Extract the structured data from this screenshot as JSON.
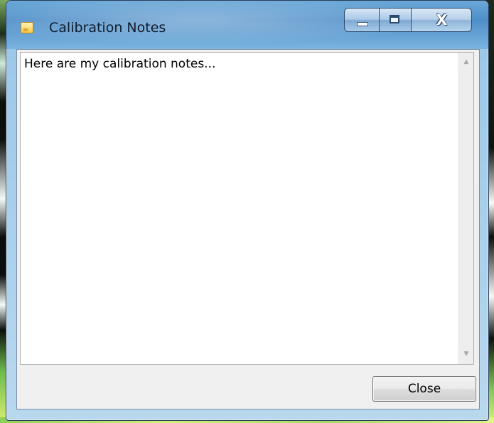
{
  "window": {
    "title": "Calibration Notes",
    "caption_buttons": {
      "minimize_icon": "minimize-icon",
      "maximize_icon": "maximize-icon",
      "close_icon": "close-icon",
      "close_glyph": "X"
    }
  },
  "notes": {
    "text": "Here are my calibration notes...",
    "scroll_up_glyph": "▲",
    "scroll_down_glyph": "▼"
  },
  "footer": {
    "close_label": "Close"
  },
  "colors": {
    "titlebar": "#5f9fd3",
    "client_background": "#f0f0f0",
    "textarea_background": "#ffffff"
  }
}
